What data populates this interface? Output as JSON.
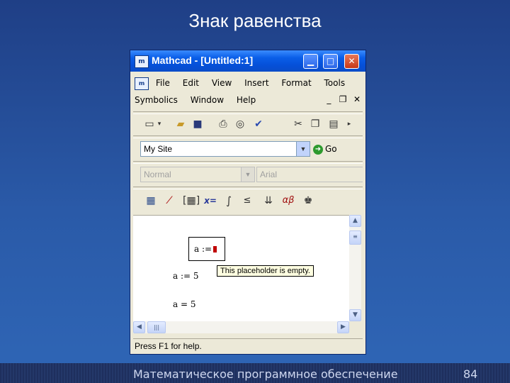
{
  "slide": {
    "title": "Знак равенства",
    "footer": "Математическое программное обеспечение",
    "page_number": "84"
  },
  "window": {
    "title": "Mathcad - [Untitled:1]",
    "app_icon_text": "m",
    "controls": {
      "minimize": "▁",
      "maximize": "□",
      "close": "✕"
    }
  },
  "menu": {
    "row1": [
      "File",
      "Edit",
      "View",
      "Insert",
      "Format",
      "Tools"
    ],
    "row2": [
      "Symbolics",
      "Window",
      "Help"
    ],
    "mdi": {
      "minimize": "_",
      "restore": "❐",
      "close": "✕"
    }
  },
  "standard_toolbar": {
    "icons": [
      "new-document",
      "open-folder",
      "save",
      "print",
      "print-preview",
      "spell-check",
      "cut",
      "copy",
      "paste"
    ]
  },
  "web_toolbar": {
    "address_value": "My Site",
    "go_label": "Go"
  },
  "formatting_toolbar": {
    "style_value": "Normal",
    "font_value": "Arial"
  },
  "math_toolbar": {
    "icons": [
      "calculator",
      "graph",
      "matrix",
      "evaluation",
      "calculus",
      "boolean",
      "programming",
      "greek",
      "symbolic"
    ]
  },
  "worksheet": {
    "region1": "a :=",
    "tooltip": "This placeholder is empty.",
    "region2": "a := 5",
    "region3": "a = 5"
  },
  "status": {
    "text": "Press F1 for help."
  }
}
